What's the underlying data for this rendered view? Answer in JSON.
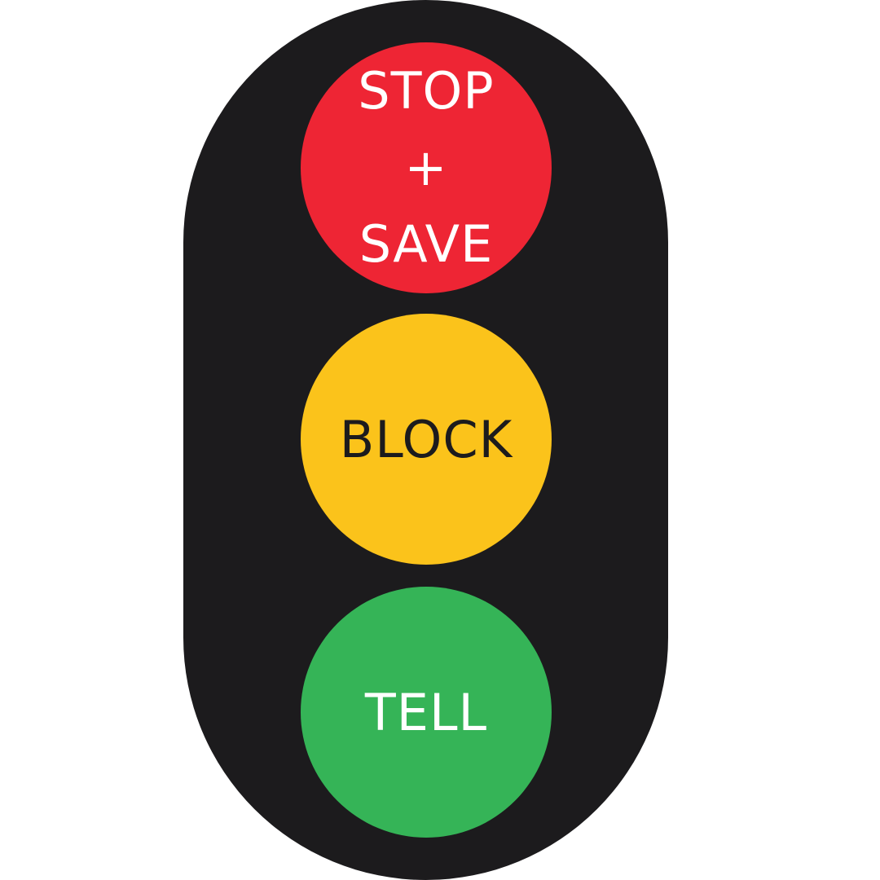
{
  "colors": {
    "background": "#ffffff",
    "housing": "#1c1b1d",
    "red": "#ee2534",
    "yellow": "#fbc31b",
    "green": "#35b457",
    "text_light": "#ffffff",
    "text_dark": "#1c1b1d"
  },
  "lights": {
    "red": {
      "line1": "STOP",
      "line2": "+",
      "line3": "SAVE"
    },
    "yellow": {
      "label": "BLOCK"
    },
    "green": {
      "label": "TELL"
    }
  }
}
